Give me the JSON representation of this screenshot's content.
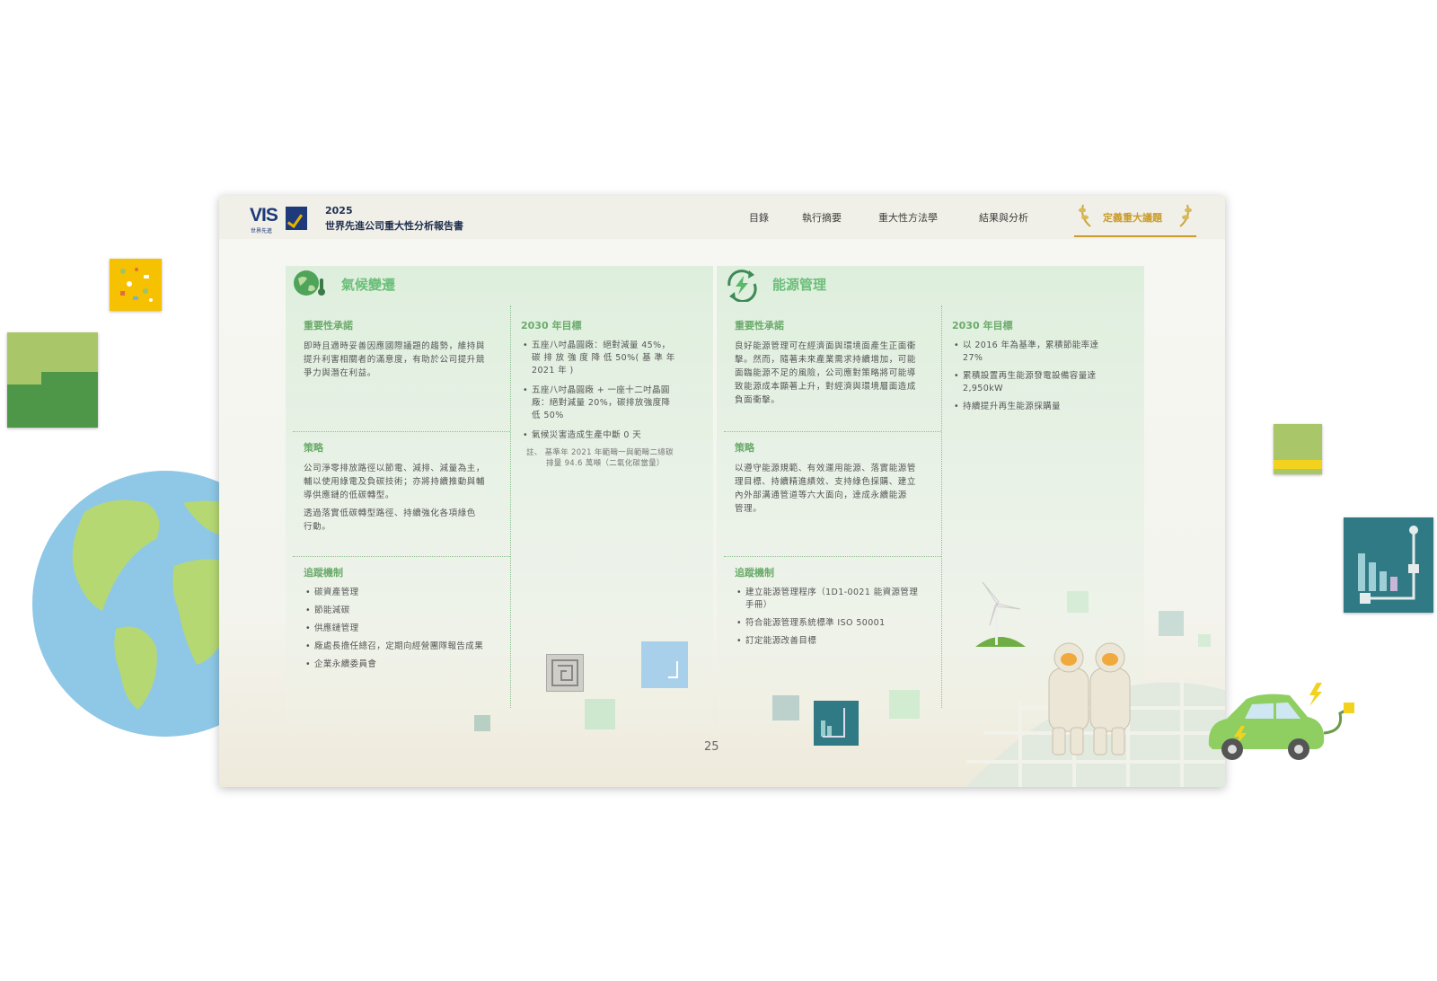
{
  "report": {
    "year": "2025",
    "title": "世界先進公司重大性分析報告書",
    "logo_text": "VIS",
    "logo_sub": "世界先進"
  },
  "nav": {
    "items": [
      "目錄",
      "執行摘要",
      "重大性方法學",
      "結果與分析",
      "定義重大議題"
    ],
    "active_index": 4
  },
  "climate": {
    "title": "氣候變遷",
    "icon": "earth-thermometer-icon",
    "commitment_heading": "重要性承諾",
    "commitment_text": [
      "即時且適時妥善因應國際議題的趨勢，維持與",
      "提升利害相關者的滿意度，有助於公司提升競",
      "爭力與潛在利益。"
    ],
    "strategy_heading": "策略",
    "strategy_text": [
      "公司淨零排放路徑以節電、減排、減量為主，",
      "輔以使用綠電及負碳技術；亦將持續推動與輔",
      "導供應鏈的低碳轉型。"
    ],
    "strategy_text2": [
      "透過落實低碳轉型路徑、持續強化各項綠色",
      "行動。"
    ],
    "tracking_heading": "追蹤機制",
    "tracking_items": [
      "碳資產管理",
      "節能減碳",
      "供應鏈管理",
      "廠處長擔任總召，定期向經營團隊報告成果",
      "企業永續委員會"
    ],
    "goal_heading": "2030 年目標",
    "goal_items": [
      [
        "五座八吋晶圓廠：絕對減量 45%，",
        "碳 排 放 強 度 降 低 50%( 基 準 年",
        "2021 年 )"
      ],
      [
        "五座八吋晶圓廠 + 一座十二吋晶圓",
        "廠：絕對減量 20%，碳排放強度降",
        "低 50%"
      ],
      [
        "氣候災害造成生產中斷 0 天"
      ]
    ],
    "note": [
      "註、 基準年 2021 年範疇一與範疇二總碳",
      "排量 94.6 萬噸（二氧化碳當量）"
    ]
  },
  "energy": {
    "title": "能源管理",
    "icon": "energy-cycle-icon",
    "commitment_heading": "重要性承諾",
    "commitment_text": [
      "良好能源管理可在經濟面與環境面產生正面衝",
      "擊。然而，隨著未來產業需求持續增加，可能",
      "面臨能源不足的風險，公司應對策略將可能導",
      "致能源成本顯著上升，對經濟與環境層面造成",
      "負面衝擊。"
    ],
    "strategy_heading": "策略",
    "strategy_text": [
      "以遵守能源規範、有效運用能源、落實能源管",
      "理目標、持續精進績效、支持綠色採購、建立",
      "內外部溝通管道等六大面向，達成永續能源",
      "管理。"
    ],
    "tracking_heading": "追蹤機制",
    "tracking_items": [
      [
        "建立能源管理程序（1D1-0021 能資源管理",
        "手冊）"
      ],
      [
        "符合能源管理系統標準 ISO 50001"
      ],
      [
        "訂定能源改善目標"
      ]
    ],
    "goal_heading": "2030 年目標",
    "goal_items": [
      [
        "以 2016 年為基準，累積節能率達",
        "27%"
      ],
      [
        "累積設置再生能源發電設備容量達",
        "2,950kW"
      ],
      [
        "持續提升再生能源採購量"
      ]
    ]
  },
  "page_number": "25",
  "colors": {
    "accent_green": "#6bbf79",
    "heading_green": "#6bab6b",
    "gold": "#c99b2b",
    "navy": "#1e3a7a"
  },
  "decor_icons": [
    "globe-icon",
    "wind-turbine-icon",
    "cleanroom-workers-icon",
    "electric-car-icon",
    "chart-tile-icon",
    "circuit-tile-icon",
    "laurel-icon"
  ]
}
